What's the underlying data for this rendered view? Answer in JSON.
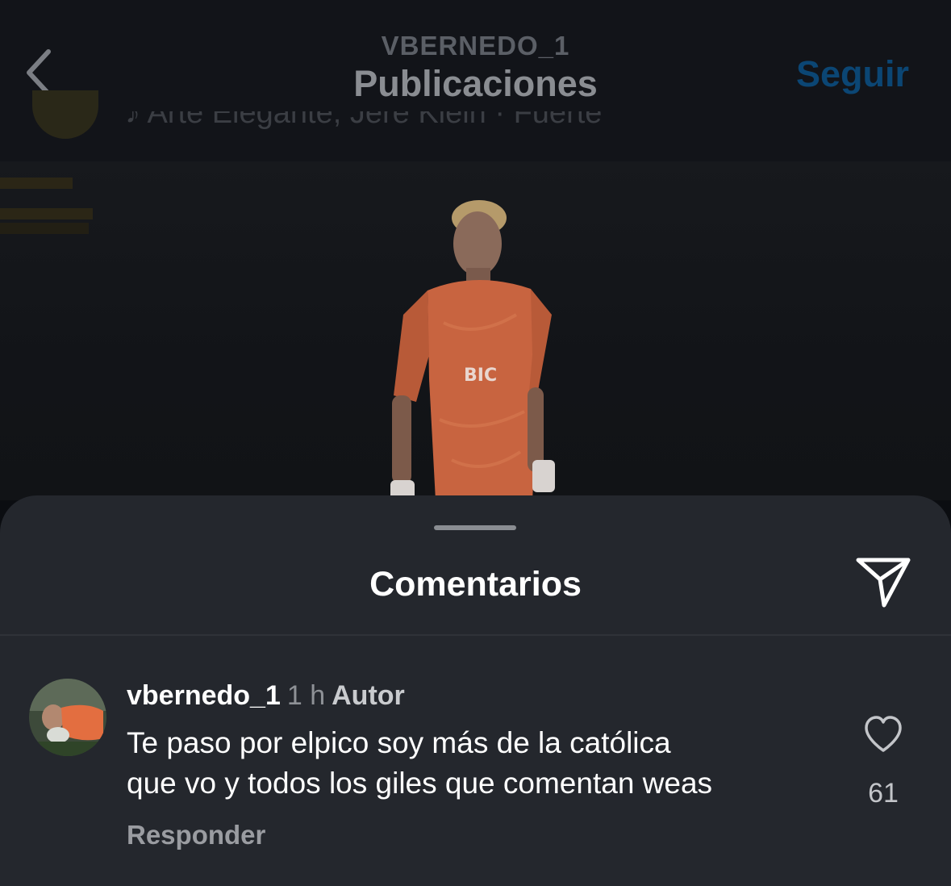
{
  "header": {
    "username": "VBERNEDO_1",
    "title": "Publicaciones",
    "follow_label": "Seguir",
    "back_icon": "chevron-left-icon"
  },
  "post": {
    "music": "♪ Arte Elegante, Jere Klein · Fuerte"
  },
  "sheet": {
    "title": "Comentarios",
    "share_icon": "paper-plane-icon"
  },
  "comment": {
    "username": "vbernedo_1",
    "time": "1 h",
    "author_badge": "Autor",
    "text": "Te paso por elpico soy más de la católica\nque vo y todos los giles que comentan weas",
    "reply_label": "Responder",
    "like_count": "61",
    "like_icon": "heart-outline-icon"
  },
  "colors": {
    "follow": "#0b4674",
    "sheet_background": "#24272d",
    "header_background": "#121419",
    "jersey": "#e0754a"
  }
}
